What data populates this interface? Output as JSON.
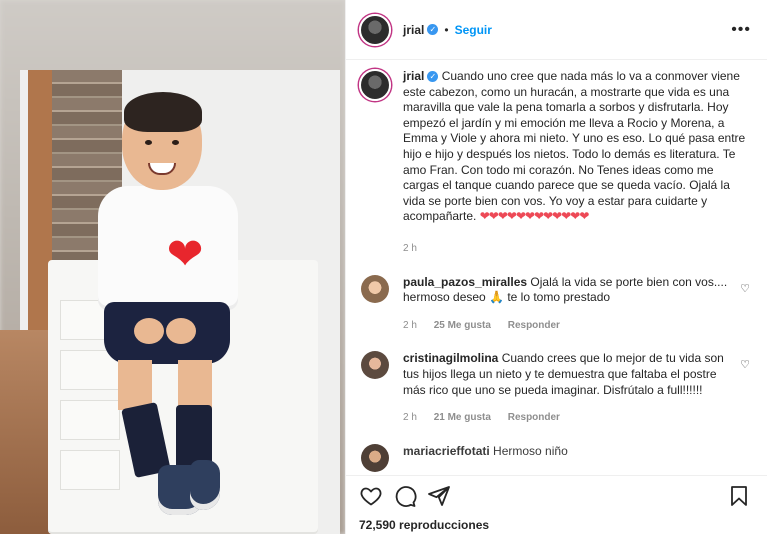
{
  "post": {
    "username": "jrial",
    "follow_label": "Seguir",
    "more_icon": "more-options-icon"
  },
  "caption": {
    "username": "jrial",
    "text": "Cuando uno cree que nada más lo va a conmover viene este cabezon, como un huracán, a mostrarte que vida es una maravilla que vale la pena tomarla a sorbos y disfrutarla. Hoy empezó el jardín y mi emoción me lleva a Rocio y Morena, a Emma y Viole y ahora mi nieto. Y uno es eso. Lo qué pasa entre hijo e hijo y después los nietos. Todo lo demás es literatura. Te amo Fran. Con todo mi corazón. No Tenes ideas como me cargas el tanque cuando parece que se queda vacío. Ojalá la vida se porte bien con vos. Yo voy a estar para cuidarte y acompañarte.",
    "hearts": "❤❤❤❤❤❤❤❤❤❤❤❤",
    "time": "2 h"
  },
  "comments": [
    {
      "username": "paula_pazos_miralles",
      "text": "Ojalá la vida se porte bien con vos.... hermoso deseo 🙏 te lo tomo prestado",
      "time": "2 h",
      "likes": "25 Me gusta",
      "reply_label": "Responder"
    },
    {
      "username": "cristinagilmolina",
      "text": "Cuando crees que lo mejor de tu vida son tus hijos llega un nieto y te demuestra que faltaba el postre más rico que uno se pueda imaginar. Disfrútalo a full!!!!!!",
      "time": "2 h",
      "likes": "21 Me gusta",
      "reply_label": "Responder"
    },
    {
      "username": "mariacrieffotati",
      "text": "Hermoso niño"
    }
  ],
  "actions": {
    "views": "72,590 reproducciones"
  },
  "photo": {
    "sticker": "❤"
  },
  "colors": {
    "accent": "#0095f6",
    "verified": "#3897f0",
    "hearts": "#ed4956",
    "muted": "#8e8e8e"
  }
}
